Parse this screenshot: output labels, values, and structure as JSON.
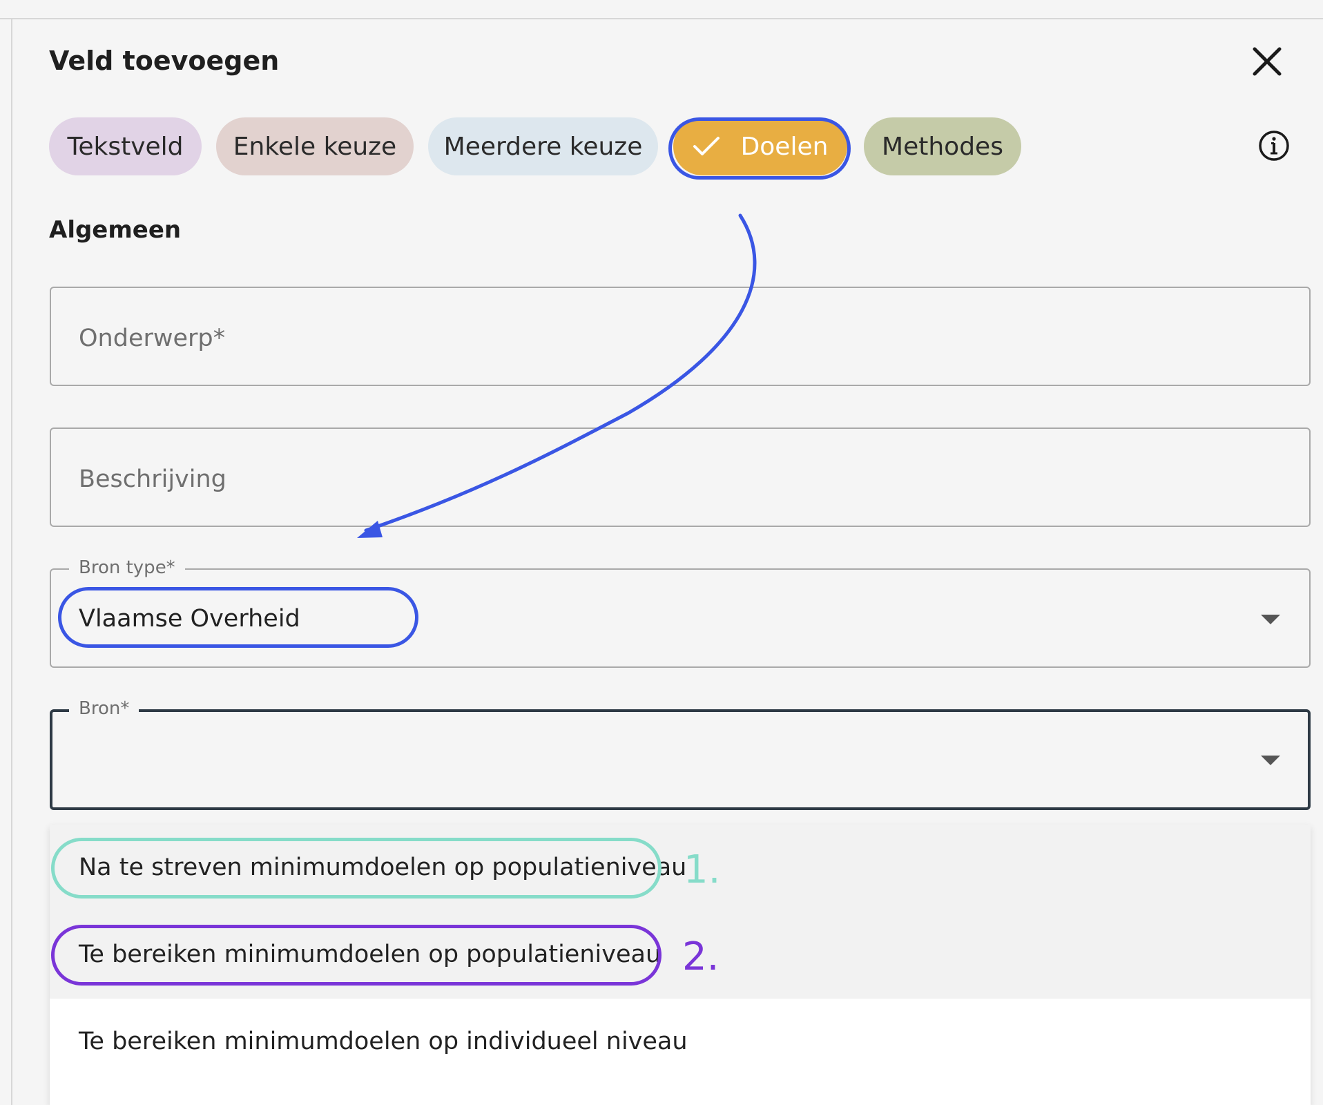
{
  "dialog": {
    "title": "Veld toevoegen",
    "close_icon": "close-icon"
  },
  "field_types": [
    {
      "label": "Tekstveld",
      "color": "#e1d3e6",
      "selected": false
    },
    {
      "label": "Enkele keuze",
      "color": "#e2d2cf",
      "selected": false
    },
    {
      "label": "Meerdere keuze",
      "color": "#dde7ee",
      "selected": false
    },
    {
      "label": "Doelen",
      "color": "#e8ae42",
      "selected": true,
      "icon": "check-icon"
    },
    {
      "label": "Methodes",
      "color": "#c5cba8",
      "selected": false
    }
  ],
  "info_icon": "info-icon",
  "section": {
    "heading": "Algemeen"
  },
  "form": {
    "onderwerp": {
      "placeholder": "Onderwerp*",
      "value": ""
    },
    "beschrijving": {
      "placeholder": "Beschrijving",
      "value": ""
    },
    "bron_type": {
      "label": "Bron type*",
      "value": "Vlaamse Overheid"
    },
    "bron": {
      "label": "Bron*",
      "value": "",
      "open": true
    }
  },
  "bron_options": [
    "Na te streven minimumdoelen op populatieniveau",
    "Te bereiken minimumdoelen op populatieniveau",
    "Te bereiken minimumdoelen op individueel niveau"
  ],
  "annotations": {
    "marker_1": "1.",
    "marker_2": "2.",
    "highlight_color": "#3a56e4",
    "marker_1_color": "#86dcc9",
    "marker_2_color": "#7a35d8"
  }
}
